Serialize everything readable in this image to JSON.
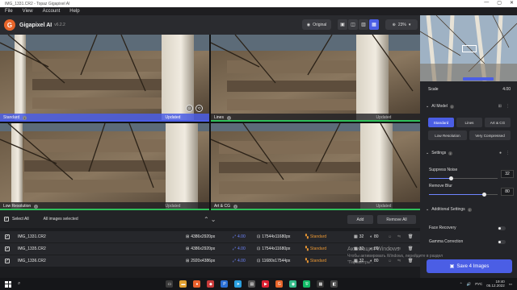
{
  "window": {
    "title": "IMG_1331.CR2 - Topaz Gigapixel AI",
    "controls": [
      "—",
      "▢",
      "✕"
    ]
  },
  "menu": [
    "File",
    "View",
    "Account",
    "Help"
  ],
  "header": {
    "app_name": "Gigapixel AI",
    "version": "v6.2.2",
    "original_label": "Original",
    "zoom": "23%"
  },
  "panes": [
    {
      "label": "Standard",
      "status": "Updated",
      "selected": true
    },
    {
      "label": "Lines",
      "status": "Updated",
      "selected": false
    },
    {
      "label": "Low Resolution",
      "status": "Updated",
      "selected": false
    },
    {
      "label": "Art & CG",
      "status": "Updated",
      "selected": false
    }
  ],
  "list": {
    "select_all": "Select All",
    "all_selected": "All images selected",
    "add": "Add",
    "remove_all": "Remove All",
    "rows": [
      {
        "name": "IMG_1331.CR2",
        "input": "4386x2920px",
        "scale": "4.00",
        "output": "17544x11680px",
        "model": "Standard",
        "suppress": "32",
        "blur": "80"
      },
      {
        "name": "IMG_1335.CR2",
        "input": "4386x2920px",
        "scale": "4.00",
        "output": "17544x11680px",
        "model": "Standard",
        "suppress": "32",
        "blur": "80"
      },
      {
        "name": "IMG_1336.CR2",
        "input": "2920x4386px",
        "scale": "4.00",
        "output": "11680x17544px",
        "model": "Standard",
        "suppress": "32",
        "blur": "80"
      }
    ]
  },
  "sidebar": {
    "scale_label": "Scale",
    "scale_value": "4.00",
    "ai_model_label": "AI Model",
    "models": [
      "Standard",
      "Lines",
      "Art & CG",
      "Low Resolution",
      "Very Compressed"
    ],
    "settings_label": "Settings",
    "suppress_noise_label": "Suppress Noise",
    "suppress_noise_value": "32",
    "suppress_noise_level": 0.32,
    "remove_blur_label": "Remove Blur",
    "remove_blur_value": "80",
    "remove_blur_level": 0.8,
    "additional_label": "Additional Settings",
    "face_recovery_label": "Face Recovery",
    "gamma_label": "Gamma Correction",
    "save_label": "Save 4 Images"
  },
  "watermark": {
    "line1": "Активация Windows",
    "line2": "Чтобы активировать Windows, перейдите в раздел",
    "line3": "\"Параметры\"."
  },
  "taskbar": {
    "time": "19:40",
    "date": "05.12.2022",
    "lang": "РУС"
  },
  "colors": {
    "accent": "#4b5ee5",
    "orange": "#e89633",
    "green": "#2fbf5a",
    "logo": "#e7652a"
  }
}
